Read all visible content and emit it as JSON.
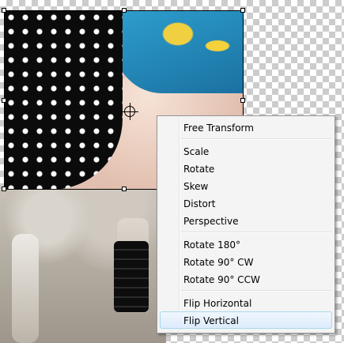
{
  "canvas": {
    "background": "transparency-checkerboard"
  },
  "context_menu": {
    "groups": [
      {
        "items": [
          {
            "label": "Free Transform"
          }
        ]
      },
      {
        "items": [
          {
            "label": "Scale"
          },
          {
            "label": "Rotate"
          },
          {
            "label": "Skew"
          },
          {
            "label": "Distort"
          },
          {
            "label": "Perspective"
          }
        ]
      },
      {
        "items": [
          {
            "label": "Rotate 180°"
          },
          {
            "label": "Rotate 90° CW"
          },
          {
            "label": "Rotate 90° CCW"
          }
        ]
      },
      {
        "items": [
          {
            "label": "Flip Horizontal"
          },
          {
            "label": "Flip Vertical",
            "highlighted": true
          }
        ]
      }
    ]
  },
  "colors": {
    "menu_background": "#f4f4f4",
    "menu_highlight": "#dcebfc",
    "menu_border": "#979797"
  }
}
